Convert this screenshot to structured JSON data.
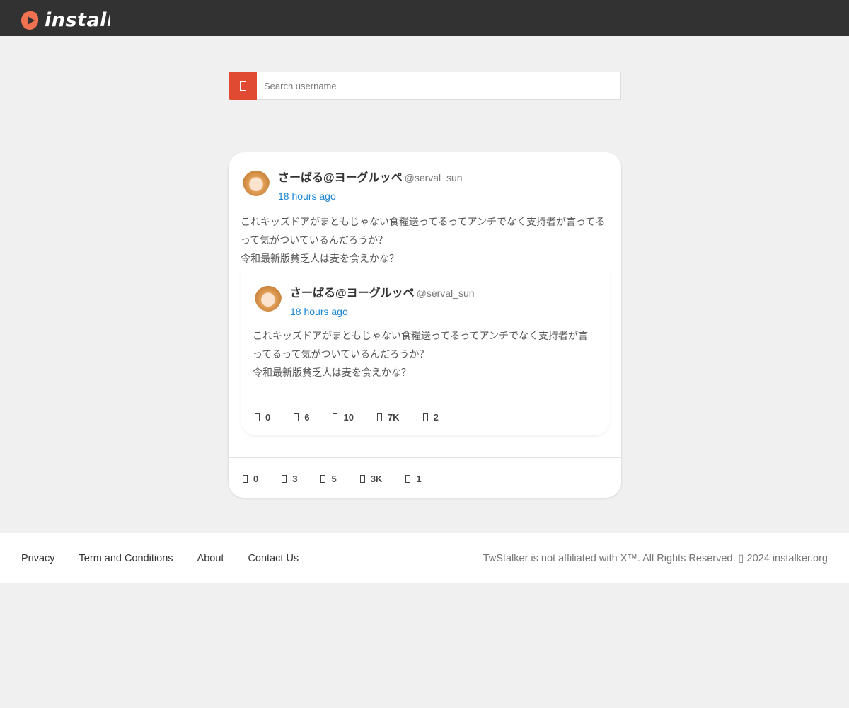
{
  "brand": {
    "name": "instalker"
  },
  "search": {
    "placeholder": "Search username"
  },
  "post": {
    "display_name": "さーばる@ヨーグルッペ",
    "handle": "@serval_sun",
    "time": "18 hours ago",
    "text_lines": [
      "これキッズドアがまともじゃない食糧送ってるってアンチでなく支持者が言ってる",
      "って気がついているんだろうか？",
      "令和最新版貧乏人は麦を食えかな？"
    ],
    "stats": [
      "0",
      "3",
      "5",
      "3K",
      "1"
    ],
    "quote": {
      "display_name": "さーばる@ヨーグルッペ",
      "handle": "@serval_sun",
      "time": "18 hours ago",
      "text_lines": [
        "これキッズドアがまともじゃない食糧送ってるってアンチでなく支持者が言",
        "ってるって気がついているんだろうか？",
        "令和最新版貧乏人は麦を食えかな？"
      ],
      "stats": [
        "0",
        "6",
        "10",
        "7K",
        "2"
      ]
    }
  },
  "footer": {
    "links": [
      "Privacy",
      "Term and Conditions",
      "About",
      "Contact Us"
    ],
    "copyright": "TwStalker is not affiliated with X™. All Rights Reserved. ▯ 2024 instalker.org"
  }
}
